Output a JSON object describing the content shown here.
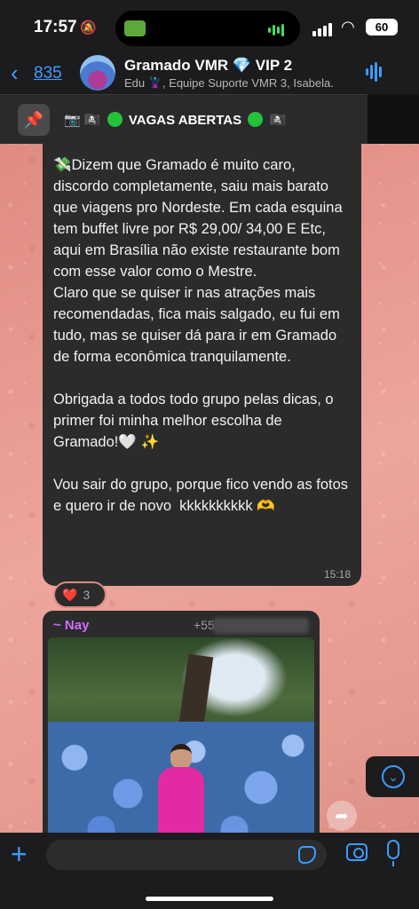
{
  "status": {
    "time": "17:57",
    "battery": "60"
  },
  "header": {
    "back_count": "835",
    "group_name": "Gramado VMR",
    "group_vip": "VIP 2",
    "members": "Edu 🦹‍♂️, Equipe Suporte VMR 3, Isabela..."
  },
  "pinned": {
    "text": "VAGAS ABERTAS"
  },
  "message": {
    "text": "💸Dizem que Gramado é muito caro, discordo completamente, saiu mais barato que viagens pro Nordeste. Em cada esquina tem buffet livre por R$ 29,00/ 34,00 E Etc, aqui em Brasília não existe restaurante bom com esse valor como o Mestre.\nClaro que se quiser ir nas atrações mais recomendadas, fica mais salgado, eu fui em tudo, mas se quiser dá para ir em Gramado de forma econômica tranquilamente.\n\nObrigada a todos todo grupo pelas dicas, o primer foi minha melhor escolha de Gramado!🤍 ✨\n\nVou sair do grupo, porque fico vendo as fotos e quero ir de novo  kkkkkkkkkk 🫶",
    "time": "15:18",
    "reaction_emoji": "❤️",
    "reaction_count": "3"
  },
  "image_message": {
    "sender": "~ Nay",
    "phone_prefix": "+55"
  },
  "input": {
    "placeholder": ""
  },
  "colors": {
    "accent": "#3d9bff",
    "bubble": "#2b2b2c",
    "sender": "#d36bff",
    "pin_dot": "#25c13b"
  }
}
